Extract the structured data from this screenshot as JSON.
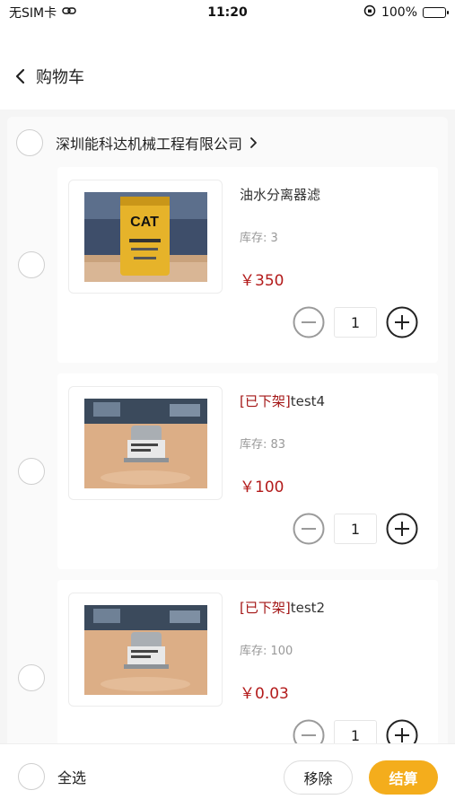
{
  "status_bar": {
    "carrier": "无SIM卡",
    "time": "11:20",
    "battery": "100%"
  },
  "nav": {
    "title": "购物车"
  },
  "shop": {
    "name": "深圳能科达机械工程有限公司"
  },
  "items": [
    {
      "tag": "",
      "title": "油水分离器滤",
      "stock": "库存: 3",
      "price": "￥350",
      "qty": "1"
    },
    {
      "tag": "[已下架]",
      "title": "test4",
      "stock": "库存: 83",
      "price": "￥100",
      "qty": "1"
    },
    {
      "tag": "[已下架]",
      "title": "test2",
      "stock": "库存: 100",
      "price": "￥0.03",
      "qty": "1"
    }
  ],
  "bottom": {
    "select_all": "全选",
    "remove": "移除",
    "checkout": "结算"
  },
  "colors": {
    "accent": "#f4ad1c",
    "price": "#b31b1b",
    "tag": "#a31515"
  }
}
